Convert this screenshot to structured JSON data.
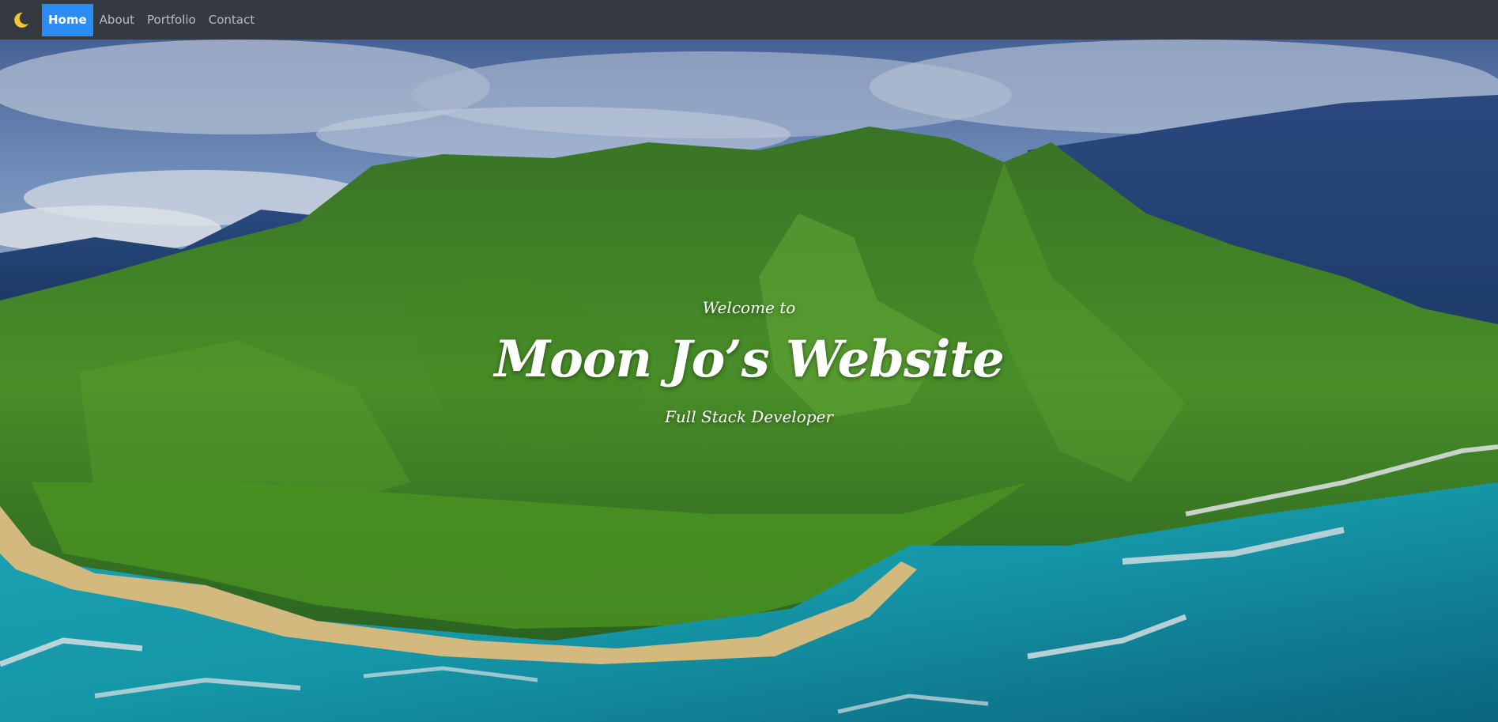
{
  "navbar": {
    "brand_icon": "moon-icon",
    "items": [
      {
        "label": "Home",
        "active": true
      },
      {
        "label": "About",
        "active": false
      },
      {
        "label": "Portfolio",
        "active": false
      },
      {
        "label": "Contact",
        "active": false
      }
    ]
  },
  "hero": {
    "welcome": "Welcome to",
    "title": "Moon Jo’s Website",
    "subtitle": "Full Stack Developer"
  },
  "colors": {
    "navbar_bg": "#343a40",
    "active_bg": "#2b8cf3",
    "nav_text": "#b9bcc0"
  }
}
